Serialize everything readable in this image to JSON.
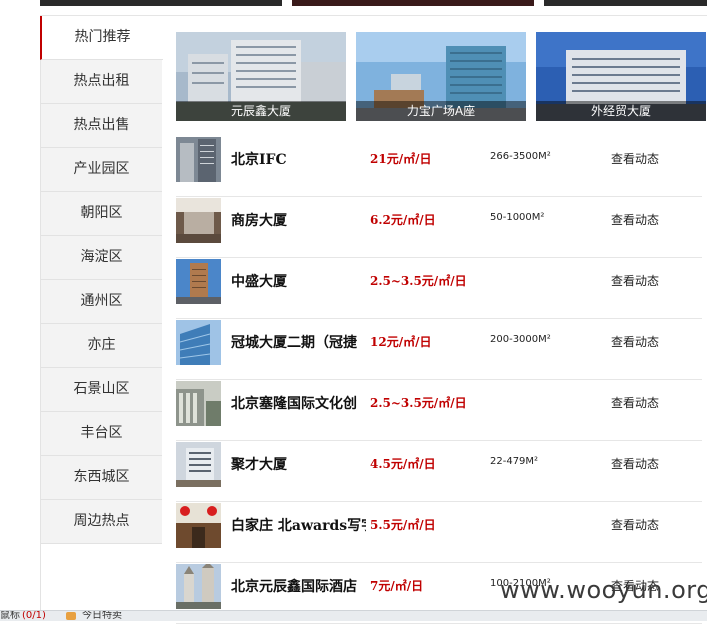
{
  "sidebar": {
    "items": [
      {
        "label": "热门推荐",
        "active": true
      },
      {
        "label": "热点出租"
      },
      {
        "label": "热点出售"
      },
      {
        "label": "产业园区"
      },
      {
        "label": "朝阳区"
      },
      {
        "label": "海淀区"
      },
      {
        "label": "通州区"
      },
      {
        "label": "亦庄"
      },
      {
        "label": "石景山区"
      },
      {
        "label": "丰台区"
      },
      {
        "label": "东西城区"
      },
      {
        "label": "周边热点"
      }
    ]
  },
  "banners": [
    {
      "caption": "元辰鑫大厦"
    },
    {
      "caption": "力宝广场A座"
    },
    {
      "caption": "外经贸大厦"
    }
  ],
  "listings": [
    {
      "name": "北京IFC",
      "price": "21元/㎡/日",
      "area": "266-3500M²",
      "action": "查看动态"
    },
    {
      "name": "商房大厦",
      "price": "6.2元/㎡/日",
      "area": "50-1000M²",
      "action": "查看动态"
    },
    {
      "name": "中盛大厦",
      "price": "2.5~3.5元/㎡/日",
      "area": "",
      "action": "查看动态"
    },
    {
      "name": "冠城大厦二期（冠捷",
      "price": "12元/㎡/日",
      "area": "200-3000M²",
      "action": "查看动态"
    },
    {
      "name": "北京塞隆国际文化创",
      "price": "2.5~3.5元/㎡/日",
      "area": "",
      "action": "查看动态"
    },
    {
      "name": "聚才大厦",
      "price": "4.5元/㎡/日",
      "area": "22-479M²",
      "action": "查看动态"
    },
    {
      "name": "白家庄 北awards写字楼",
      "price": "5.5元/㎡/日",
      "area": "",
      "action": "查看动态"
    },
    {
      "name": "北京元辰鑫国际酒店",
      "price": "7元/㎡/日",
      "area": "100-2100M²",
      "action": "查看动态"
    }
  ],
  "watermark": "www.wooyun.org",
  "bottom_bar": {
    "left_text": "鼠标",
    "mid_text": "(0/1)",
    "right_text": "今日特卖"
  },
  "colors": {
    "accent": "#c00000",
    "sidebar_bg": "#f3f3f3",
    "divider": "#e6e6e6"
  }
}
